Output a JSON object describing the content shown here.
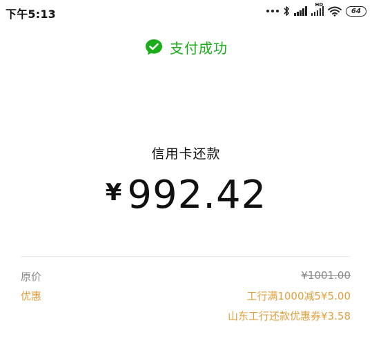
{
  "status_bar": {
    "time": "下午5:13",
    "hd_label": "HD",
    "battery": "64",
    "icons": [
      "more-dots-icon",
      "bluetooth-icon",
      "signal-icon",
      "signal-hd-icon",
      "wifi-icon",
      "battery-icon"
    ]
  },
  "result": {
    "icon": "wechat-pay-check-icon",
    "status_text": "支付成功",
    "accent_color": "#1aad19"
  },
  "payment": {
    "merchant": "信用卡还款",
    "currency": "¥",
    "amount": "992.42"
  },
  "details": {
    "original_price_label": "原价",
    "original_price_value": "¥1001.00",
    "discount_label": "优惠",
    "discounts": [
      "工行满1000减5¥5.00",
      "山东工行还款优惠券¥3.58"
    ],
    "discount_color": "#e09f3e"
  }
}
